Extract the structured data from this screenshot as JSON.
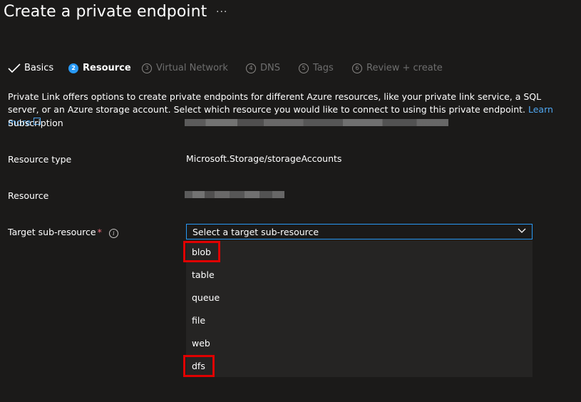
{
  "page": {
    "title": "Create a private endpoint",
    "more": "···"
  },
  "steps": [
    {
      "label": "Basics",
      "state": "done"
    },
    {
      "num": "2",
      "label": "Resource",
      "state": "active"
    },
    {
      "num": "3",
      "label": "Virtual Network",
      "state": "disabled"
    },
    {
      "num": "4",
      "label": "DNS",
      "state": "disabled"
    },
    {
      "num": "5",
      "label": "Tags",
      "state": "disabled"
    },
    {
      "num": "6",
      "label": "Review + create",
      "state": "disabled"
    }
  ],
  "description": {
    "text": "Private Link offers options to create private endpoints for different Azure resources, like your private link service, a SQL server, or an Azure storage account. Select which resource you would like to connect to using this private endpoint.",
    "link": "Learn more"
  },
  "fields": {
    "subscription": {
      "label": "Subscription"
    },
    "resource_type": {
      "label": "Resource type",
      "value": "Microsoft.Storage/storageAccounts"
    },
    "resource": {
      "label": "Resource"
    },
    "target": {
      "label": "Target sub-resource",
      "required": "*",
      "info": "i",
      "placeholder": "Select a target sub-resource"
    }
  },
  "dropdown": {
    "options": [
      "blob",
      "table",
      "queue",
      "file",
      "web",
      "dfs"
    ],
    "highlighted": [
      "blob",
      "dfs"
    ]
  },
  "colors": {
    "accent": "#2899f5",
    "highlight": "#e00000",
    "background": "#1b1a19"
  }
}
